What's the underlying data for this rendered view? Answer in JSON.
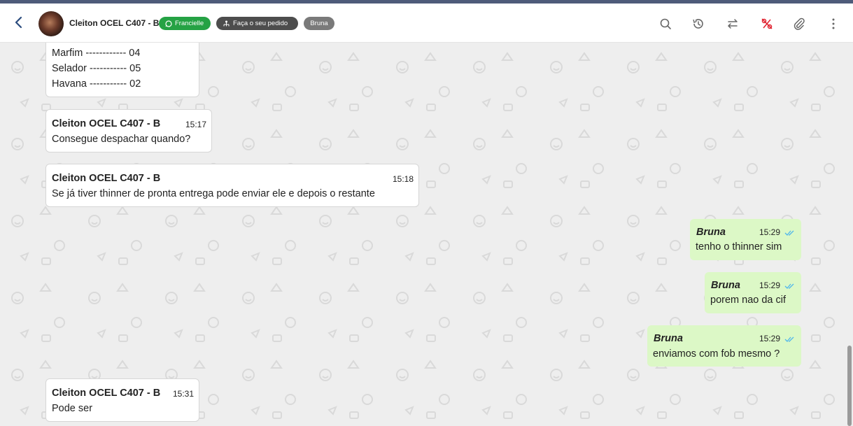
{
  "header": {
    "contact_name": "Cleiton OCEL C407 - B",
    "tags": {
      "agent": "Francielle",
      "order": "Faça o seu pedido",
      "user": "Bruna"
    },
    "icons": [
      "back-arrow-icon",
      "search-icon",
      "history-icon",
      "transfer-icon",
      "no-percent-icon",
      "paperclip-icon",
      "more-vertical-icon"
    ],
    "colors": {
      "agent_tag": "#25a244",
      "order_tag": "#4d4d4d",
      "user_tag": "#7a7a7a",
      "alert_icon": "#e0202e"
    }
  },
  "messages": [
    {
      "direction": "in",
      "lines": [
        "Marfim ------------ 04",
        "Selador ----------- 05",
        "Havana ----------- 02"
      ]
    },
    {
      "direction": "in",
      "sender": "Cleiton OCEL C407 - B",
      "time": "15:17",
      "text": "Consegue despachar quando?"
    },
    {
      "direction": "in",
      "sender": "Cleiton OCEL C407 - B",
      "time": "15:18",
      "text": "Se já tiver thinner de pronta entrega pode enviar ele e depois o restante"
    },
    {
      "direction": "out",
      "sender": "Bruna",
      "time": "15:29",
      "text": "tenho o thinner sim"
    },
    {
      "direction": "out",
      "sender": "Bruna",
      "time": "15:29",
      "text": "porem nao da cif"
    },
    {
      "direction": "out",
      "sender": "Bruna",
      "time": "15:29",
      "text": "enviamos com fob mesmo ?"
    },
    {
      "direction": "in",
      "sender": "Cleiton OCEL C407 - B",
      "time": "15:31",
      "text": "Pode ser"
    }
  ],
  "colors": {
    "outgoing_bubble": "#dcf8c6",
    "incoming_bubble": "#ffffff",
    "read_checks": "#4fb6ec",
    "chat_background": "#eeeeee"
  }
}
